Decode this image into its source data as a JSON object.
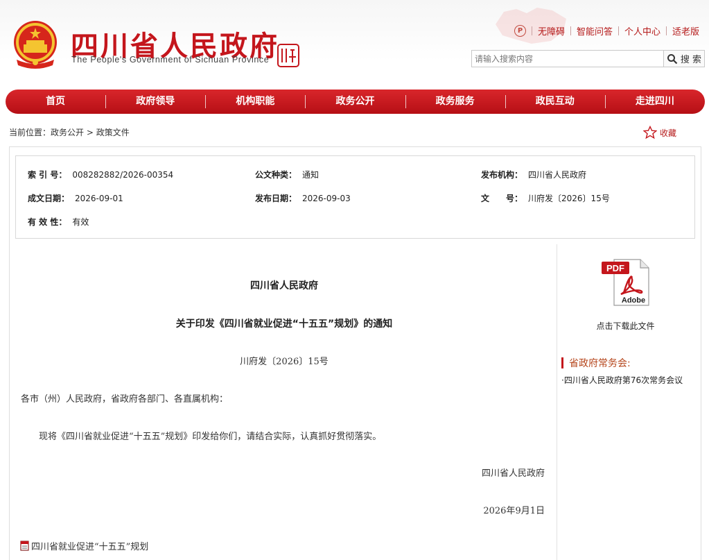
{
  "header": {
    "site_title": "四川省人民政府",
    "site_subtitle": "The People's Government of Sichuan Province",
    "seal_text": "四川",
    "top_links": [
      "无障碍",
      "智能问答",
      "个人中心",
      "适老版"
    ],
    "search": {
      "placeholder": "请输入搜索内容",
      "button_label": "搜 索"
    }
  },
  "nav": {
    "items": [
      "首页",
      "政府领导",
      "机构职能",
      "政务公开",
      "政务服务",
      "政民互动",
      "走进四川"
    ]
  },
  "breadcrumb": {
    "prefix": "当前位置：",
    "path": [
      "政务公开",
      "政策文件"
    ],
    "separator": ">"
  },
  "favorite_label": "收藏",
  "meta": {
    "index_no": {
      "key": "索 引 号：",
      "value": "008282882/2026-00354"
    },
    "doc_type": {
      "key": "公文种类：",
      "value": "通知"
    },
    "issuer": {
      "key": "发布机构：",
      "value": "四川省人民政府"
    },
    "created_date": {
      "key": "成文日期：",
      "value": "2026-09-01"
    },
    "publish_date": {
      "key": "发布日期：",
      "value": "2026-09-03"
    },
    "doc_no": {
      "key": "文　　号：",
      "value": "川府发〔2026〕15号"
    },
    "validity": {
      "key": "有 效 性：",
      "value": "有效"
    }
  },
  "article": {
    "org": "四川省人民政府",
    "title": "关于印发《四川省就业促进“十五五”规划》的通知",
    "doc_no": "川府发〔2026〕15号",
    "salutation": "各市（州）人民政府，省政府各部门、各直属机构：",
    "body": "现将《四川省就业促进“十五五”规划》印发给你们，请结合实际，认真抓好贯彻落实。",
    "signature": "四川省人民政府",
    "date": "2026年9月1日",
    "attachment": "四川省就业促进“十五五”规划"
  },
  "sidebar": {
    "pdf_badge": "PDF",
    "pdf_brand": "Adobe",
    "download_label": "点击下载此文件",
    "section_title": "省政府常务会:",
    "items": [
      "·四川省人民政府第76次常务会议"
    ]
  },
  "colors": {
    "brand_red": "#c4161c",
    "nav_red": "#c8171d",
    "accent_orange": "#b5451b"
  }
}
